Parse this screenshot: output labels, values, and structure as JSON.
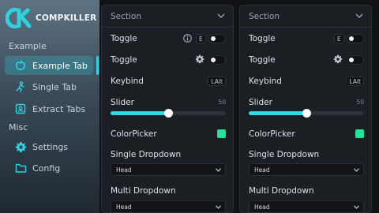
{
  "app": {
    "name": "COMPKILLER"
  },
  "sidebar": {
    "groups": [
      {
        "label": "Example",
        "items": [
          {
            "label": "Example Tab",
            "icon": "apple-icon",
            "active": true
          },
          {
            "label": "Single Tab",
            "icon": "figure-icon",
            "active": false
          },
          {
            "label": "Extract Tabs",
            "icon": "contact-card-icon",
            "active": false
          }
        ]
      },
      {
        "label": "Misc",
        "items": [
          {
            "label": "Settings",
            "icon": "gear-icon",
            "active": false
          },
          {
            "label": "Config",
            "icon": "folder-icon",
            "active": false
          }
        ]
      }
    ]
  },
  "panels": [
    {
      "title": "Section",
      "toggle1": {
        "label": "Toggle",
        "key": "E",
        "on": false
      },
      "toggle2": {
        "label": "Toggle",
        "on": false
      },
      "keybind": {
        "label": "Keybind",
        "key": "LAlt"
      },
      "slider": {
        "label": "Slider",
        "value": "50",
        "fraction": 0.5
      },
      "colorpicker": {
        "label": "ColorPicker",
        "color": "#22e39a"
      },
      "single_dropdown": {
        "label": "Single Dropdown",
        "value": "Head"
      },
      "multi_dropdown": {
        "label": "Multi Dropdown",
        "value": "Head"
      }
    },
    {
      "title": "Section",
      "toggle1": {
        "label": "Toggle",
        "key": "E",
        "on": false
      },
      "toggle2": {
        "label": "Toggle",
        "on": false
      },
      "keybind": {
        "label": "Keybind",
        "key": "LAlt"
      },
      "slider": {
        "label": "Slider",
        "value": "50",
        "fraction": 0.5
      },
      "colorpicker": {
        "label": "ColorPicker",
        "color": "#22e39a"
      },
      "single_dropdown": {
        "label": "Single Dropdown",
        "value": "Head"
      },
      "multi_dropdown": {
        "label": "Multi Dropdown",
        "value": "Head"
      }
    }
  ],
  "colors": {
    "accent": "#2fd9e4",
    "panel": "#1b1e23",
    "background": "#101216"
  }
}
